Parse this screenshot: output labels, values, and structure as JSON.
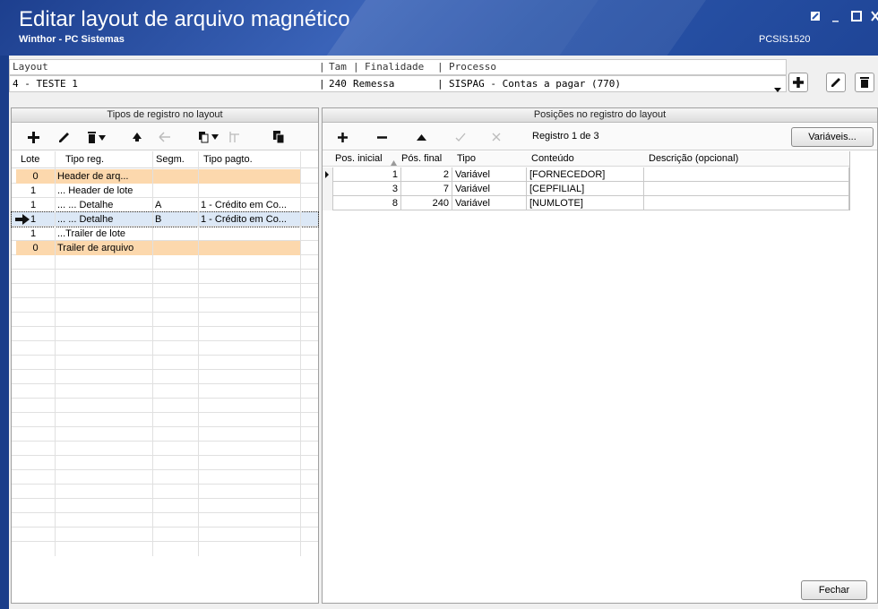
{
  "window": {
    "title": "Editar layout de arquivo magnético",
    "subtitle": "Winthor - PC Sistemas",
    "code": "PCSIS1520"
  },
  "header": {
    "labels": {
      "layout": "Layout",
      "tam": "Tam",
      "finalidade": "Finalidade",
      "processo": "Processo"
    },
    "values": {
      "layout": "4 - TESTE 1",
      "tam": "240",
      "finalidade": "Remessa",
      "processo": "SISPAG - Contas a pagar (770)"
    }
  },
  "left_panel": {
    "title": "Tipos de registro no layout",
    "columns": {
      "lote": "Lote",
      "tipo": "Tipo reg.",
      "segm": "Segm.",
      "pagto": "Tipo pagto."
    },
    "rows": [
      {
        "lote": "0",
        "tipo": "Header de arq...",
        "segm": "",
        "pagto": ""
      },
      {
        "lote": "1",
        "tipo": "... Header de lote",
        "segm": "",
        "pagto": ""
      },
      {
        "lote": "1",
        "tipo": "... ... Detalhe",
        "segm": "A",
        "pagto": "1 - Crédito em Co..."
      },
      {
        "lote": "1",
        "tipo": "... ... Detalhe",
        "segm": "B",
        "pagto": "1 - Crédito em Co..."
      },
      {
        "lote": "1",
        "tipo": "...Trailer de lote",
        "segm": "",
        "pagto": ""
      },
      {
        "lote": "0",
        "tipo": "Trailer de arquivo",
        "segm": "",
        "pagto": ""
      }
    ]
  },
  "right_panel": {
    "title": "Posições no registro do layout",
    "record_counter": "Registro 1 de 3",
    "variables_button": "Variáveis...",
    "columns": {
      "ini": "Pos. inicial",
      "fim": "Pós. final",
      "tipo": "Tipo",
      "conteudo": "Conteúdo",
      "desc": "Descrição (opcional)"
    },
    "rows": [
      {
        "ini": "1",
        "fim": "2",
        "tipo": "Variável",
        "conteudo": "[FORNECEDOR]",
        "desc": ""
      },
      {
        "ini": "3",
        "fim": "7",
        "tipo": "Variável",
        "conteudo": "[CEPFILIAL]",
        "desc": ""
      },
      {
        "ini": "8",
        "fim": "240",
        "tipo": "Variável",
        "conteudo": "[NUMLOTE]",
        "desc": ""
      }
    ]
  },
  "footer": {
    "close_button": "Fechar"
  },
  "colors": {
    "titlebar": "#2a55aa",
    "orange_row": "#fcd8ad",
    "selected_row": "#dce8f6"
  }
}
